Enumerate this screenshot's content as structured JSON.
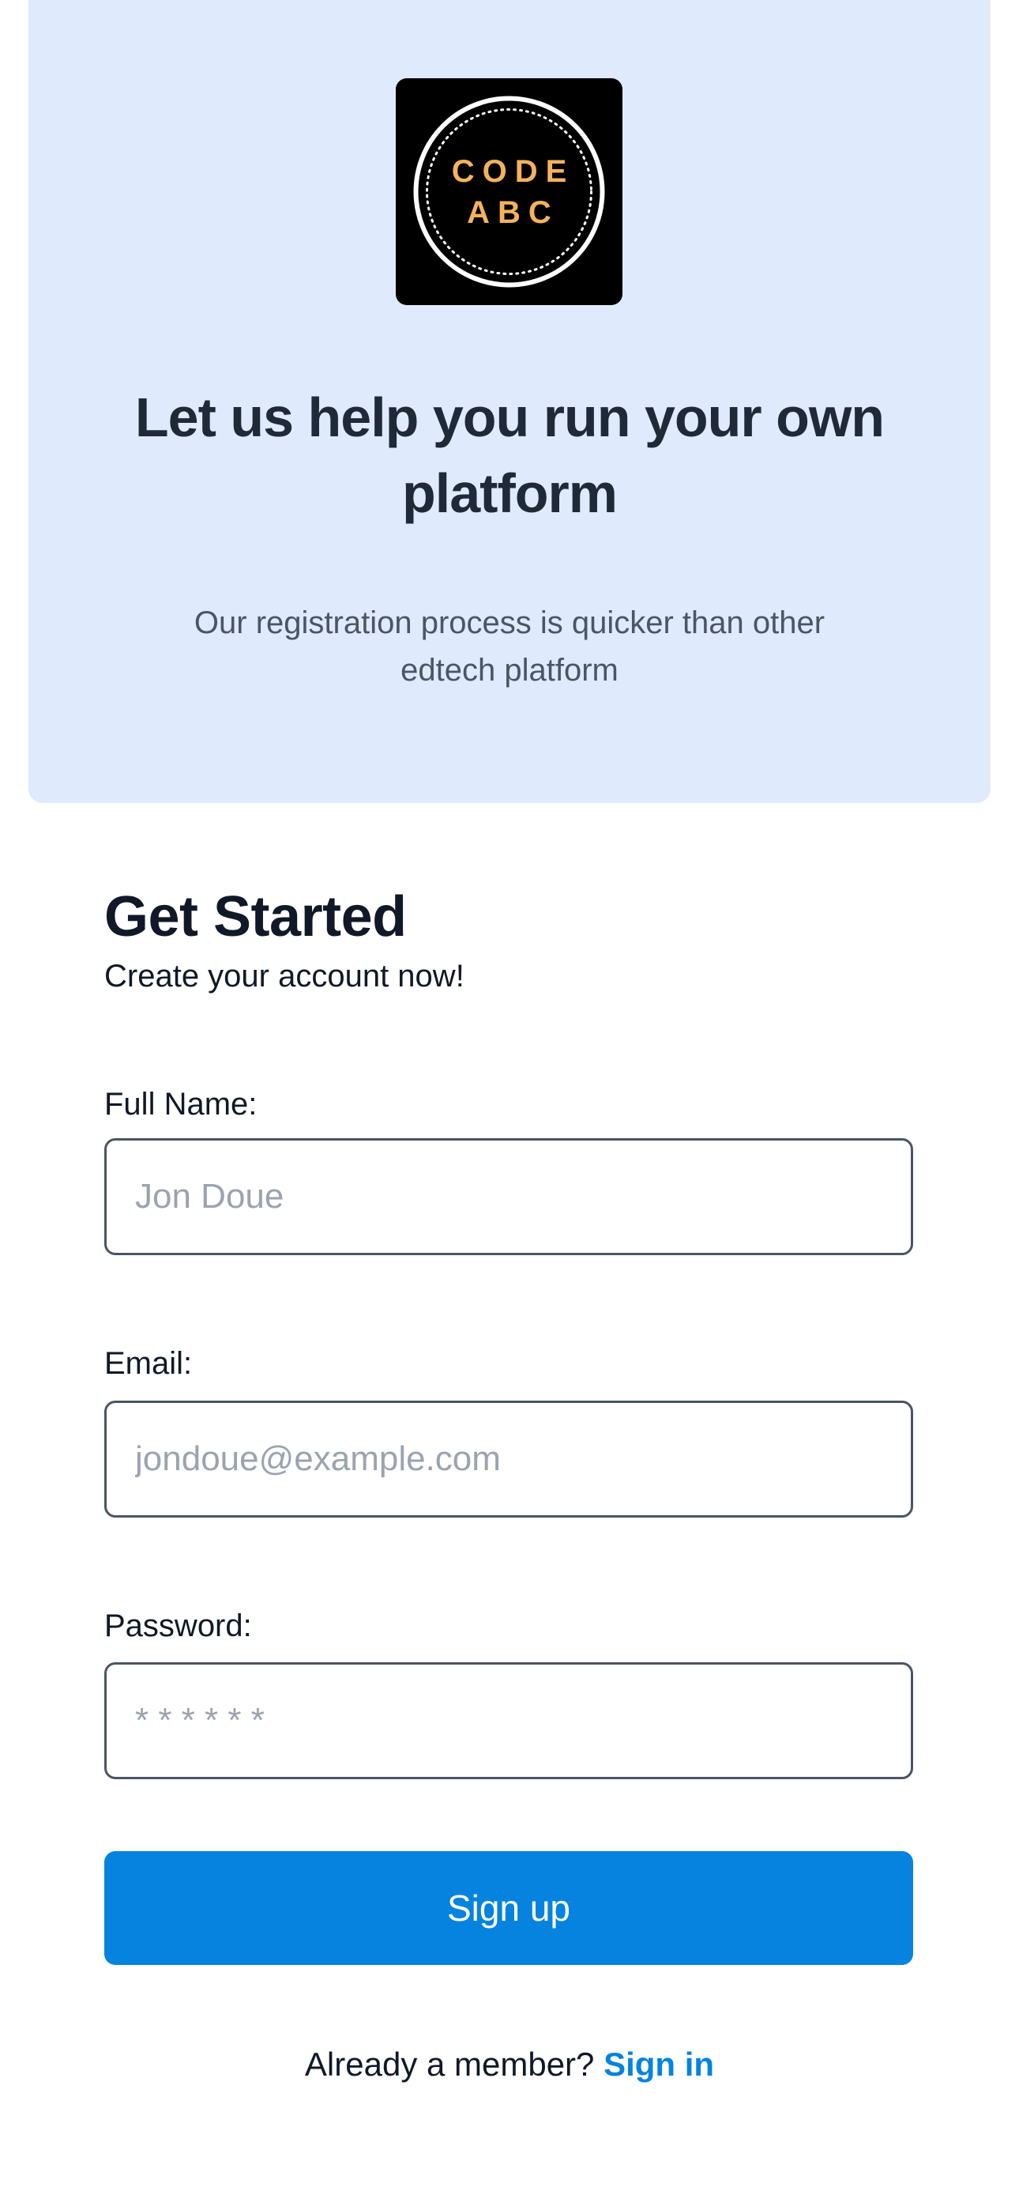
{
  "hero": {
    "logo_line1": "CODE",
    "logo_line2": "ABC",
    "title": "Let us help you run your own platform",
    "subtitle": "Our registration process is quicker than other edtech platform"
  },
  "form": {
    "title": "Get Started",
    "subtitle": "Create your account now!",
    "full_name": {
      "label": "Full Name:",
      "placeholder": "Jon Doue",
      "value": ""
    },
    "email": {
      "label": "Email:",
      "placeholder": "jondoue@example.com",
      "value": ""
    },
    "password": {
      "label": "Password:",
      "placeholder": "* * * * * *",
      "value": ""
    },
    "signup_label": "Sign up",
    "member_text": "Already a member?",
    "signin_label": "Sign in"
  },
  "colors": {
    "hero_background": "#dfeafc",
    "accent": "#0583df",
    "logo_text": "#f5b25c",
    "heading": "#1f2937"
  },
  "icons": {
    "logo": "code-abc-logo-icon"
  }
}
